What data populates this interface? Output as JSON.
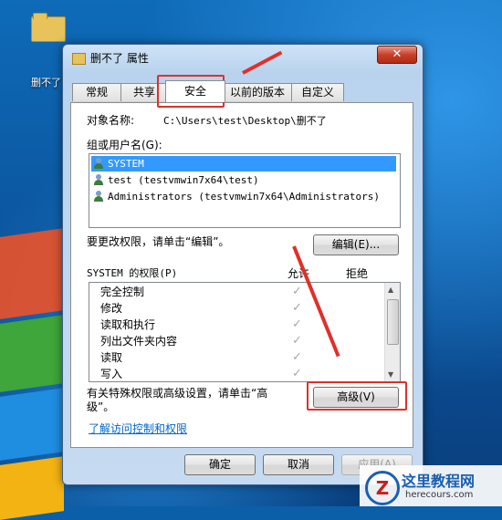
{
  "desktop": {
    "icon_label": "删不了"
  },
  "window": {
    "title": "删不了 属性",
    "close_glyph": "✕",
    "tabs": [
      {
        "label": "常规"
      },
      {
        "label": "共享"
      },
      {
        "label": "安全"
      },
      {
        "label": "以前的版本"
      },
      {
        "label": "自定义"
      }
    ],
    "active_tab": "安全"
  },
  "security": {
    "object_name_label": "对象名称:",
    "object_name_value": "C:\\Users\\test\\Desktop\\删不了",
    "group_label": "组或用户名(G):",
    "users": [
      {
        "name": "SYSTEM",
        "selected": true
      },
      {
        "name": "test (testvmwin7x64\\test)",
        "selected": false
      },
      {
        "name": "Administrators (testvmwin7x64\\Administrators)",
        "selected": false
      }
    ],
    "edit_hint": "要更改权限，请单击“编辑”。",
    "edit_button": "编辑(E)...",
    "perm_label": "SYSTEM 的权限(P)",
    "allow_header": "允许",
    "deny_header": "拒绝",
    "permissions": [
      {
        "name": "完全控制",
        "allow": true
      },
      {
        "name": "修改",
        "allow": true
      },
      {
        "name": "读取和执行",
        "allow": true
      },
      {
        "name": "列出文件夹内容",
        "allow": true
      },
      {
        "name": "读取",
        "allow": true
      },
      {
        "name": "写入",
        "allow": true
      }
    ],
    "check_glyph": "✓",
    "advanced_hint_line1": "有关特殊权限或高级设置，请单击“高",
    "advanced_hint_line2": "级”。",
    "advanced_button": "高级(V)",
    "learn_link": "了解访问控制和权限"
  },
  "footer": {
    "ok_button": "确定",
    "cancel_button": "取消",
    "apply_button": "应用(A)"
  },
  "watermark": {
    "logo_letter": "Z",
    "name": "这里教程网",
    "site": "herecours.com"
  },
  "colors": {
    "highlight_red": "#e0302a",
    "selection_blue": "#3399ff",
    "link_blue": "#0066cc"
  }
}
